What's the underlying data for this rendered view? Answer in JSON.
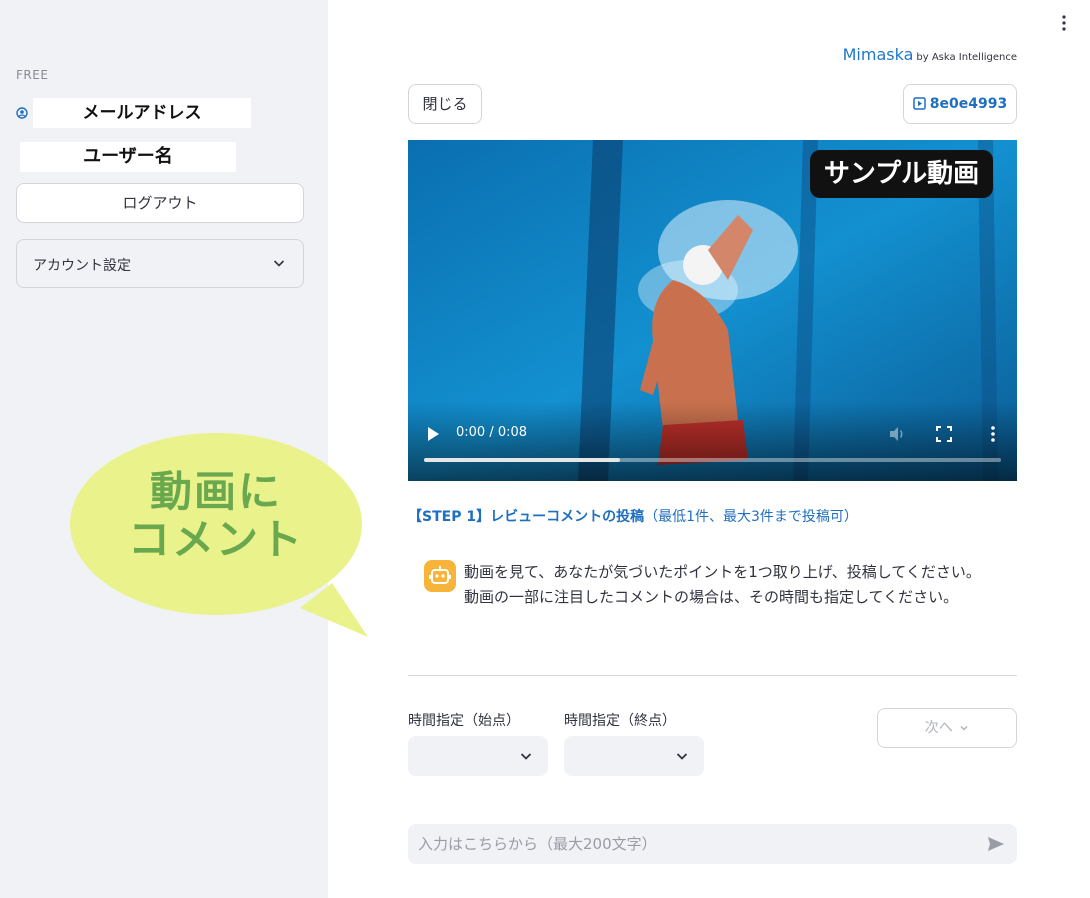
{
  "sidebar": {
    "plan": "FREE",
    "email_label": "メールアドレス",
    "username_label": "ユーザー名",
    "logout_label": "ログアウト",
    "account_settings_label": "アカウント設定"
  },
  "callout": {
    "line1": "動画に",
    "line2": "コメント"
  },
  "header": {
    "brand": "Mimaska",
    "brand_sub": "by Aska Intelligence",
    "close_label": "閉じる",
    "video_id": "8e0e4993"
  },
  "video": {
    "overlay_label": "サンプル動画",
    "time": "0:00 / 0:08",
    "progress": 0.34
  },
  "step": {
    "title_bold": "【STEP 1】レビューコメントの投稿",
    "title_note": "（最低1件、最大3件まで投稿可）",
    "instruction_line1": "動画を見て、あなたが気づいたポイントを1つ取り上げ、投稿してください。",
    "instruction_line2": "動画の一部に注目したコメントの場合は、その時間も指定してください。"
  },
  "time_selectors": {
    "start_label": "時間指定（始点）",
    "end_label": "時間指定（終点）",
    "next_label": "次へ"
  },
  "chat": {
    "placeholder": "入力はこちらから（最大200文字）"
  },
  "colors": {
    "sidebar_bg": "#f0f2f6",
    "accent": "#1f6fc0",
    "callout_bg": "#eaf28c",
    "callout_text": "#6aa84f",
    "bot_icon": "#f7b43a"
  }
}
